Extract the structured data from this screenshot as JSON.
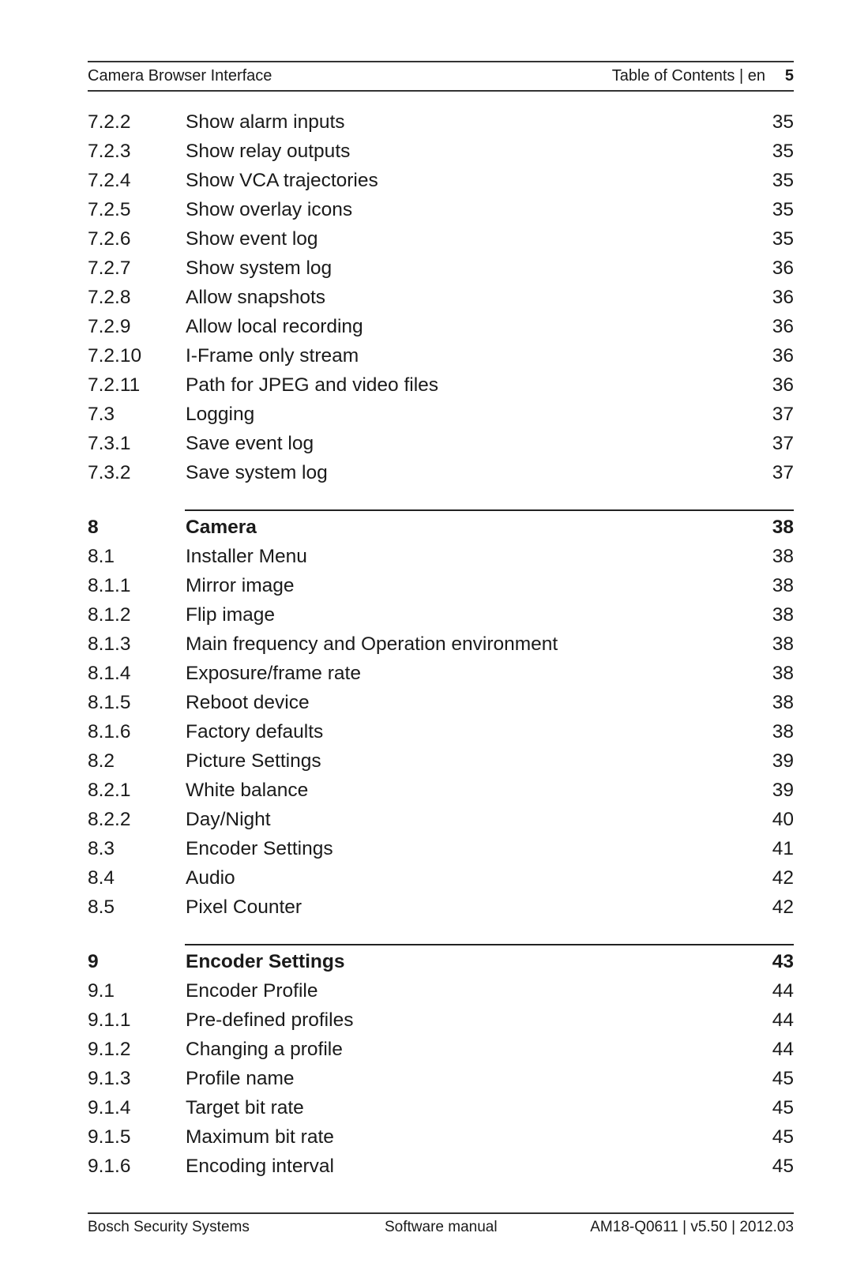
{
  "header": {
    "doc_title": "Camera Browser Interface",
    "section": "Table of Contents | en",
    "page_number": "5"
  },
  "toc": {
    "group1": [
      {
        "num": "7.2.2",
        "title": "Show alarm inputs",
        "page": "35"
      },
      {
        "num": "7.2.3",
        "title": "Show relay outputs",
        "page": "35"
      },
      {
        "num": "7.2.4",
        "title": "Show VCA trajectories",
        "page": "35"
      },
      {
        "num": "7.2.5",
        "title": "Show overlay icons",
        "page": "35"
      },
      {
        "num": "7.2.6",
        "title": "Show event log",
        "page": "35"
      },
      {
        "num": "7.2.7",
        "title": "Show system log",
        "page": "36"
      },
      {
        "num": "7.2.8",
        "title": "Allow snapshots",
        "page": "36"
      },
      {
        "num": "7.2.9",
        "title": "Allow local recording",
        "page": "36"
      },
      {
        "num": "7.2.10",
        "title": "I-Frame only stream",
        "page": "36"
      },
      {
        "num": "7.2.11",
        "title": "Path for JPEG and video files",
        "page": "36"
      },
      {
        "num": "7.3",
        "title": "Logging",
        "page": "37"
      },
      {
        "num": "7.3.1",
        "title": "Save event log",
        "page": "37"
      },
      {
        "num": "7.3.2",
        "title": "Save system log",
        "page": "37"
      }
    ],
    "chapter8": {
      "num": "8",
      "title": "Camera",
      "page": "38"
    },
    "group2": [
      {
        "num": "8.1",
        "title": "Installer Menu",
        "page": "38"
      },
      {
        "num": "8.1.1",
        "title": "Mirror image",
        "page": "38"
      },
      {
        "num": "8.1.2",
        "title": "Flip image",
        "page": "38"
      },
      {
        "num": "8.1.3",
        "title": "Main frequency and Operation environment",
        "page": "38"
      },
      {
        "num": "8.1.4",
        "title": "Exposure/frame rate",
        "page": "38"
      },
      {
        "num": "8.1.5",
        "title": "Reboot device",
        "page": "38"
      },
      {
        "num": "8.1.6",
        "title": "Factory defaults",
        "page": "38"
      },
      {
        "num": "8.2",
        "title": "Picture Settings",
        "page": "39"
      },
      {
        "num": "8.2.1",
        "title": "White balance",
        "page": "39"
      },
      {
        "num": "8.2.2",
        "title": "Day/Night",
        "page": "40"
      },
      {
        "num": "8.3",
        "title": "Encoder Settings",
        "page": "41"
      },
      {
        "num": "8.4",
        "title": "Audio",
        "page": "42"
      },
      {
        "num": "8.5",
        "title": "Pixel Counter",
        "page": "42"
      }
    ],
    "chapter9": {
      "num": "9",
      "title": "Encoder Settings",
      "page": "43"
    },
    "group3": [
      {
        "num": "9.1",
        "title": "Encoder Profile",
        "page": "44"
      },
      {
        "num": "9.1.1",
        "title": "Pre-defined profiles",
        "page": "44"
      },
      {
        "num": "9.1.2",
        "title": "Changing a profile",
        "page": "44"
      },
      {
        "num": "9.1.3",
        "title": "Profile name",
        "page": "45"
      },
      {
        "num": "9.1.4",
        "title": "Target bit rate",
        "page": "45"
      },
      {
        "num": "9.1.5",
        "title": "Maximum bit rate",
        "page": "45"
      },
      {
        "num": "9.1.6",
        "title": "Encoding interval",
        "page": "45"
      }
    ]
  },
  "footer": {
    "company": "Bosch Security Systems",
    "doc_type": "Software manual",
    "doc_id": "AM18-Q0611 | v5.50 | 2012.03"
  }
}
